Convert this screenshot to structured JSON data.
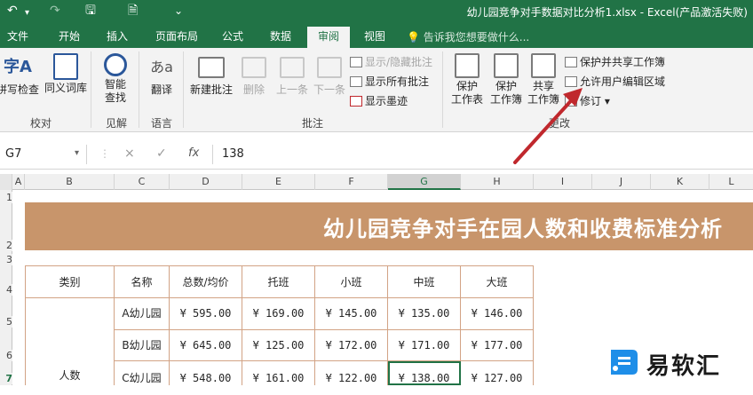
{
  "window": {
    "title": "幼儿园竞争对手数据对比分析1.xlsx - Excel(产品激活失败)",
    "qa": {
      "save": "🖫",
      "undo": "↶",
      "redo": "↷",
      "preview": "🗎",
      "more": "⌄"
    }
  },
  "tabs": [
    {
      "label": "文件"
    },
    {
      "label": "开始"
    },
    {
      "label": "插入"
    },
    {
      "label": "页面布局"
    },
    {
      "label": "公式"
    },
    {
      "label": "数据"
    },
    {
      "label": "审阅"
    },
    {
      "label": "视图"
    }
  ],
  "tellme": "告诉我您想要做什么...",
  "ribbon": {
    "proofing": {
      "spell": "拼写检查",
      "thesaurus": "同义词库",
      "group": "校对"
    },
    "insights": {
      "smart_line1": "智能",
      "smart_line2": "查找",
      "group": "见解"
    },
    "language": {
      "translate": "翻译",
      "group": "语言"
    },
    "comments": {
      "new": "新建批注",
      "delete": "删除",
      "prev": "上一条",
      "next": "下一条",
      "show_hide": "显示/隐藏批注",
      "show_all": "显示所有批注",
      "show_ink": "显示墨迹",
      "group": "批注"
    },
    "changes": {
      "protect_sheet_l1": "保护",
      "protect_sheet_l2": "工作表",
      "protect_wb_l1": "保护",
      "protect_wb_l2": "工作簿",
      "share_l1": "共享",
      "share_l2": "工作簿",
      "protect_share": "保护并共享工作簿",
      "allow_edit": "允许用户编辑区域",
      "track": "修订",
      "group": "更改"
    }
  },
  "formula_bar": {
    "name_box": "G7",
    "value": "138",
    "cancel": "×",
    "enter": "✓",
    "fx": "fx"
  },
  "columns": [
    "A",
    "B",
    "C",
    "D",
    "E",
    "F",
    "G",
    "H",
    "I",
    "J",
    "K",
    "L"
  ],
  "rows": [
    "1",
    "2",
    "3",
    "4",
    "5",
    "6",
    "7"
  ],
  "sheet": {
    "banner": "幼儿园竞争对手在园人数和收费标准分析",
    "headers": [
      "类别",
      "名称",
      "总数/均价",
      "托班",
      "小班",
      "中班",
      "大班"
    ],
    "category": "人数",
    "data": [
      [
        "A幼儿园",
        "¥ 595.00",
        "¥ 169.00",
        "¥ 145.00",
        "¥ 135.00",
        "¥ 146.00"
      ],
      [
        "B幼儿园",
        "¥ 645.00",
        "¥ 125.00",
        "¥ 172.00",
        "¥ 171.00",
        "¥ 177.00"
      ],
      [
        "C幼儿园",
        "¥ 548.00",
        "¥ 161.00",
        "¥ 122.00",
        "¥ 138.00",
        "¥ 127.00"
      ]
    ]
  },
  "watermark": {
    "text": "易软汇"
  },
  "colors": {
    "excel_green": "#217346",
    "banner": "#c8956b",
    "arrow": "#c0282d"
  }
}
